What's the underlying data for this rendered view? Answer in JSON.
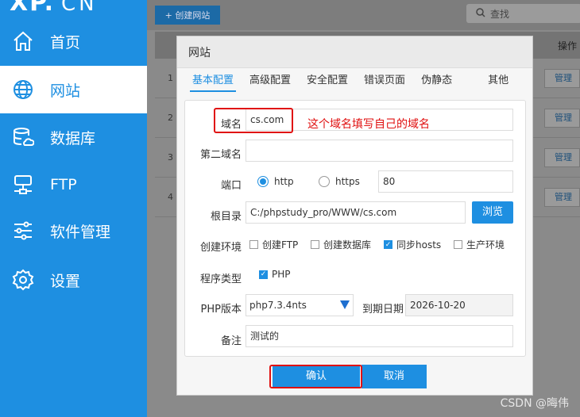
{
  "app": {
    "logo": "XP.",
    "logo_suffix": "CN"
  },
  "sidebar": {
    "items": [
      {
        "label": "首页",
        "icon": "home-icon"
      },
      {
        "label": "网站",
        "icon": "globe-icon",
        "active": true
      },
      {
        "label": "数据库",
        "icon": "database-icon"
      },
      {
        "label": "FTP",
        "icon": "server-icon"
      },
      {
        "label": "软件管理",
        "icon": "sliders-icon"
      },
      {
        "label": "设置",
        "icon": "gear-icon"
      }
    ]
  },
  "toolbar": {
    "create_label": "+ 创建网站",
    "search_placeholder": "查找"
  },
  "table": {
    "op_header": "操作",
    "rows": [
      {
        "num": "1",
        "action": "管理"
      },
      {
        "num": "2",
        "action": "管理"
      },
      {
        "num": "3",
        "action": "管理"
      },
      {
        "num": "4",
        "action": "管理"
      }
    ]
  },
  "modal": {
    "title": "网站",
    "tabs": [
      "基本配置",
      "高级配置",
      "安全配置",
      "错误页面",
      "伪静态",
      "其他"
    ],
    "active_tab": "基本配置",
    "fields": {
      "domain_label": "域名",
      "domain_value": "cs.com",
      "second_domain_label": "第二域名",
      "second_domain_value": "",
      "port_label": "端口",
      "port_http": "http",
      "port_https": "https",
      "port_value": "80",
      "root_label": "根目录",
      "root_value": "C:/phpstudy_pro/WWW/cs.com",
      "browse_label": "浏览",
      "env_label": "创建环境",
      "env_options": [
        {
          "label": "创建FTP",
          "checked": false
        },
        {
          "label": "创建数据库",
          "checked": false
        },
        {
          "label": "同步hosts",
          "checked": true
        },
        {
          "label": "生产环境",
          "checked": false
        }
      ],
      "program_label": "程序类型",
      "program_option": "PHP",
      "php_label": "PHP版本",
      "php_value": "php7.3.4nts",
      "expire_label": "到期日期",
      "expire_value": "2026-10-20",
      "note_label": "备注",
      "note_value": "测试的"
    },
    "ok_label": "确认",
    "cancel_label": "取消"
  },
  "annotation": {
    "text": "这个域名填写自己的域名"
  },
  "watermark": "CSDN @晦伟",
  "colors": {
    "accent": "#1e8fe1",
    "annotation": "#e01010"
  }
}
